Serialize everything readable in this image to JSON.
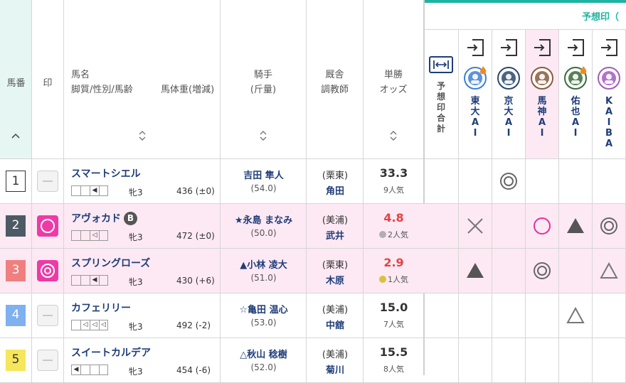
{
  "header": {
    "umaban": "馬番",
    "shirushi": "印",
    "name_line1": "馬名",
    "name_line2": "脚質/性別/馬齢",
    "weight_label": "馬体重(増減)",
    "jockey_line1": "騎手",
    "jockey_line2": "(斤量)",
    "stable_line1": "厩舎",
    "stable_line2": "調教師",
    "odds_line1": "単勝",
    "odds_line2": "オッズ",
    "sort_up": "^",
    "sort_toggle": "◇"
  },
  "prediction": {
    "title": "予想印（",
    "total_label": "予想印合計",
    "expand_icon": "|↔|",
    "accent": "#1fb3a3",
    "ais": [
      {
        "name": "東大AI",
        "avatar_color": "#3f7fd6",
        "avatar_letter": "C"
      },
      {
        "name": "京大AI",
        "avatar_color": "#2b4a6b",
        "avatar_letter": "K"
      },
      {
        "name": "馬神AI",
        "avatar_color": "#8b5a3c",
        "avatar_letter": "馬"
      },
      {
        "name": "佑也AI",
        "avatar_color": "#3a6b3a",
        "avatar_letter": "佑"
      },
      {
        "name": "KAIBA",
        "avatar_color": "#a35bc0",
        "avatar_letter": "?"
      }
    ]
  },
  "horses": [
    {
      "num": "1",
      "num_bg": "#ffffff",
      "num_fg": "#333333",
      "mark": "none",
      "name": "スマートシエル",
      "blinker": "",
      "legs": [
        "",
        "",
        "◀",
        ""
      ],
      "sex_age": "牝3",
      "weight": "436 (±0)",
      "jockey": "吉田 隼人",
      "jockey_weight": "(54.0)",
      "stable": "(栗東)",
      "trainer": "角田",
      "odds": "33.3",
      "hot": false,
      "popularity": "9人気",
      "medal": "",
      "marks": [
        "",
        "double",
        "",
        "",
        ""
      ],
      "pink": false
    },
    {
      "num": "2",
      "num_bg": "#4d5a66",
      "num_fg": "#ffffff",
      "mark": "circle",
      "name": "アヴォカド",
      "blinker": "B",
      "legs": [
        "",
        "",
        "◁",
        ""
      ],
      "sex_age": "牝3",
      "weight": "472 (±0)",
      "jockey": "★永島 まなみ",
      "jockey_weight": "(50.0)",
      "stable": "(美浦)",
      "trainer": "武井",
      "odds": "4.8",
      "hot": true,
      "popularity": "2人気",
      "medal": "#b0b0b0",
      "marks": [
        "cross",
        "",
        "circle",
        "triangle",
        "double"
      ],
      "pink": true
    },
    {
      "num": "3",
      "num_bg": "#f07f7f",
      "num_fg": "#ffffff",
      "mark": "double",
      "name": "スプリングローズ",
      "blinker": "",
      "legs": [
        "",
        "",
        "◀",
        ""
      ],
      "sex_age": "牝3",
      "weight": "430 (+6)",
      "jockey": "▲小林 凌大",
      "jockey_weight": "(51.0)",
      "stable": "(栗東)",
      "trainer": "木原",
      "odds": "2.9",
      "hot": true,
      "popularity": "1人気",
      "medal": "#d9c23a",
      "marks": [
        "triangle",
        "",
        "double",
        "",
        "open-triangle"
      ],
      "pink": true
    },
    {
      "num": "4",
      "num_bg": "#7fb0ef",
      "num_fg": "#ffffff",
      "mark": "none",
      "name": "カフェリリー",
      "blinker": "",
      "legs": [
        "",
        "◁",
        "◁",
        "◁"
      ],
      "sex_age": "牝3",
      "weight": "492 (-2)",
      "jockey": "☆亀田 温心",
      "jockey_weight": "(53.0)",
      "stable": "(美浦)",
      "trainer": "中舘",
      "odds": "15.0",
      "hot": false,
      "popularity": "7人気",
      "medal": "",
      "marks": [
        "",
        "",
        "",
        "open-triangle",
        ""
      ],
      "pink": false
    },
    {
      "num": "5",
      "num_bg": "#f5e65c",
      "num_fg": "#333333",
      "mark": "none",
      "name": "スイートカルデア",
      "blinker": "",
      "legs": [
        "◀",
        "",
        "",
        ""
      ],
      "sex_age": "牝3",
      "weight": "454 (-6)",
      "jockey": "△秋山 稔樹",
      "jockey_weight": "(52.0)",
      "stable": "(美浦)",
      "trainer": "菊川",
      "odds": "15.5",
      "hot": false,
      "popularity": "8人気",
      "medal": "",
      "marks": [
        "",
        "",
        "",
        "",
        ""
      ],
      "pink": false
    }
  ]
}
